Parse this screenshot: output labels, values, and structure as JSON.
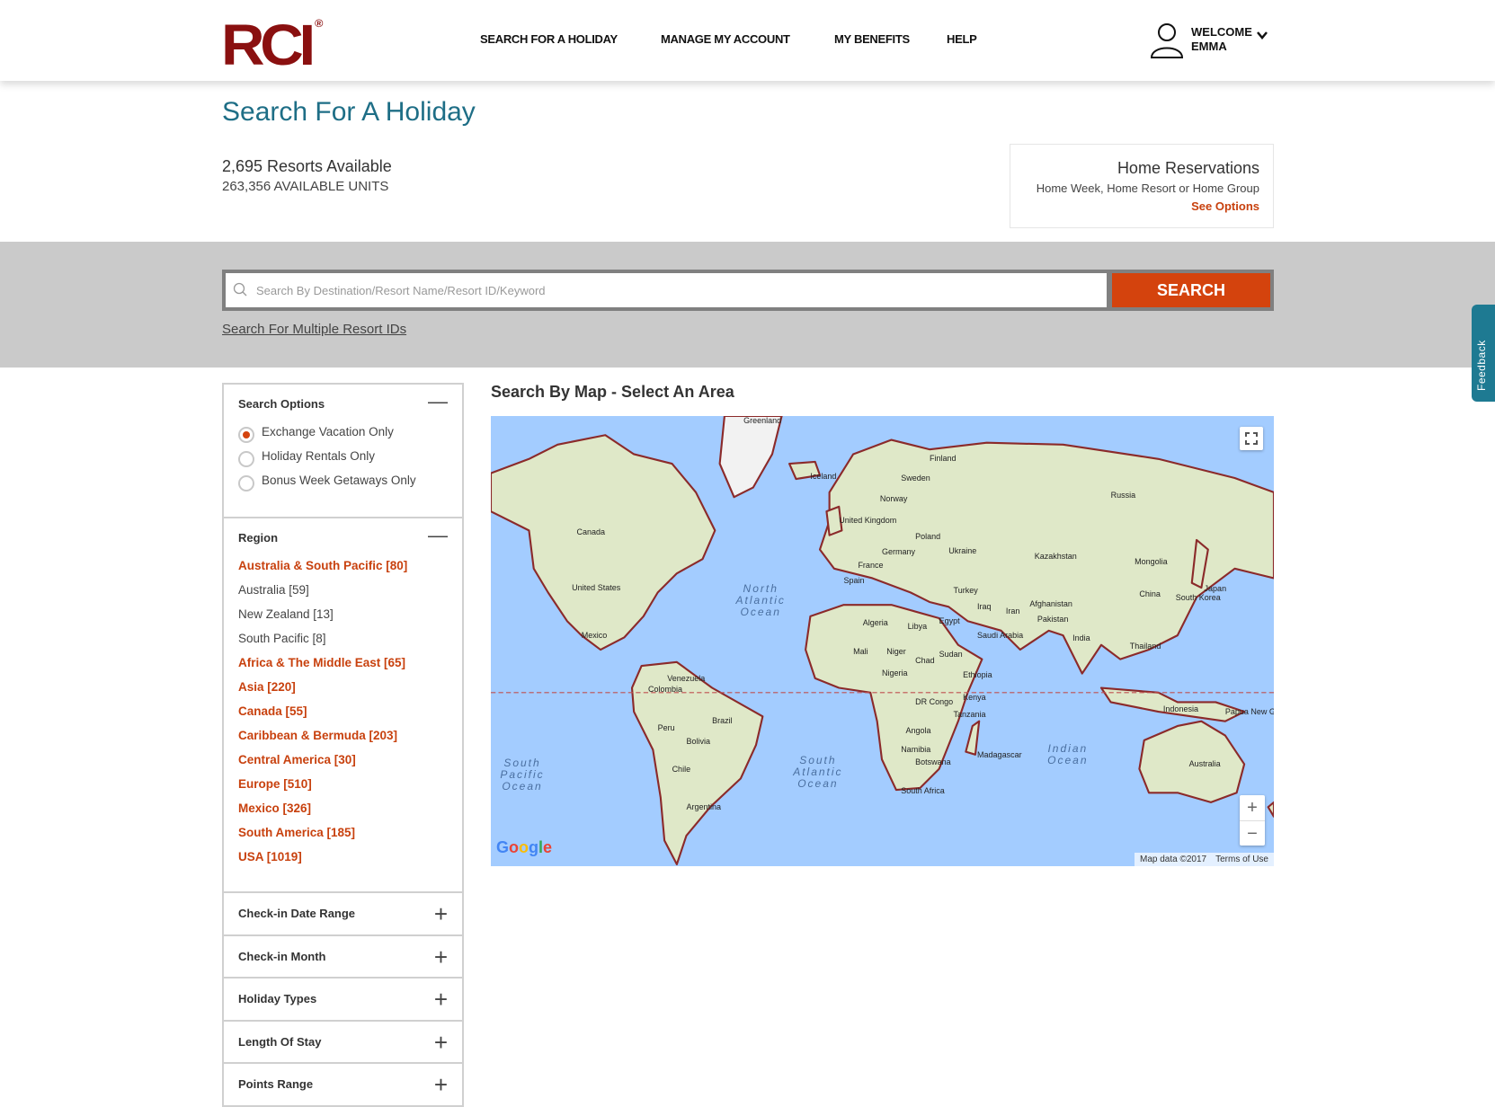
{
  "header": {
    "logo": "RCI",
    "nav": [
      "SEARCH FOR A HOLIDAY",
      "MANAGE MY ACCOUNT",
      "MY BENEFITS",
      "HELP"
    ],
    "welcome": "WELCOME",
    "user": "EMMA"
  },
  "page": {
    "title": "Search For A Holiday",
    "resorts": "2,695 Resorts Available",
    "units": "263,356 AVAILABLE UNITS"
  },
  "home": {
    "title": "Home Reservations",
    "subtitle": "Home Week, Home Resort or Home Group",
    "link": "See Options"
  },
  "search": {
    "placeholder": "Search By Destination/Resort Name/Resort ID/Keyword",
    "button": "SEARCH",
    "multi": "Search For Multiple Resort IDs"
  },
  "feedback": "Feedback",
  "sidebar": {
    "search_options": {
      "title": "Search Options",
      "options": [
        {
          "label": "Exchange Vacation Only",
          "selected": true
        },
        {
          "label": "Holiday Rentals Only",
          "selected": false
        },
        {
          "label": "Bonus Week Getaways Only",
          "selected": false
        }
      ]
    },
    "region": {
      "title": "Region",
      "items": [
        {
          "label": "Australia & South Pacific [80]",
          "bold": true
        },
        {
          "label": "Australia [59]",
          "bold": false
        },
        {
          "label": "New Zealand [13]",
          "bold": false
        },
        {
          "label": "South Pacific [8]",
          "bold": false
        },
        {
          "label": "Africa & The Middle East [65]",
          "bold": true
        },
        {
          "label": "Asia [220]",
          "bold": true
        },
        {
          "label": "Canada [55]",
          "bold": true
        },
        {
          "label": "Caribbean & Bermuda [203]",
          "bold": true
        },
        {
          "label": "Central America [30]",
          "bold": true
        },
        {
          "label": "Europe [510]",
          "bold": true
        },
        {
          "label": "Mexico [326]",
          "bold": true
        },
        {
          "label": "South America [185]",
          "bold": true
        },
        {
          "label": "USA [1019]",
          "bold": true
        }
      ]
    },
    "filters": [
      "Check-in Date Range",
      "Check-in Month",
      "Holiday Types",
      "Length Of Stay",
      "Points Range"
    ]
  },
  "map": {
    "title": "Search By Map - Select An Area",
    "countries": [
      "Greenland",
      "Iceland",
      "Canada",
      "United States",
      "Mexico",
      "Russia",
      "Finland",
      "Sweden",
      "Norway",
      "Poland",
      "Ukraine",
      "Kazakhstan",
      "Mongolia",
      "China",
      "Japan",
      "South Korea",
      "Turkey",
      "Iran",
      "Iraq",
      "Afghanistan",
      "Pakistan",
      "India",
      "Thailand",
      "Algeria",
      "Libya",
      "Egypt",
      "Saudi Arabia",
      "Mali",
      "Niger",
      "Chad",
      "Sudan",
      "Nigeria",
      "Ethiopia",
      "Kenya",
      "DR Congo",
      "Tanzania",
      "Angola",
      "Namibia",
      "Botswana",
      "South Africa",
      "Madagascar",
      "Venezuela",
      "Colombia",
      "Brazil",
      "Peru",
      "Bolivia",
      "Chile",
      "Argentina",
      "Indonesia",
      "Papua New Guinea",
      "Australia",
      "Spain",
      "France",
      "Germany",
      "United Kingdom"
    ],
    "oceans": [
      "North Atlantic Ocean",
      "South Atlantic Ocean",
      "Indian Ocean",
      "South Pacific Ocean"
    ],
    "attribution": "Map data ©2017",
    "terms": "Terms of Use",
    "google": "Google",
    "colors": {
      "water": "#a3ccff",
      "land": "#dfe8c8",
      "border": "#8b2a2a"
    }
  },
  "colors": {
    "accent": "#d4430d",
    "brand": "#8a1010",
    "title": "#1e6e86"
  }
}
